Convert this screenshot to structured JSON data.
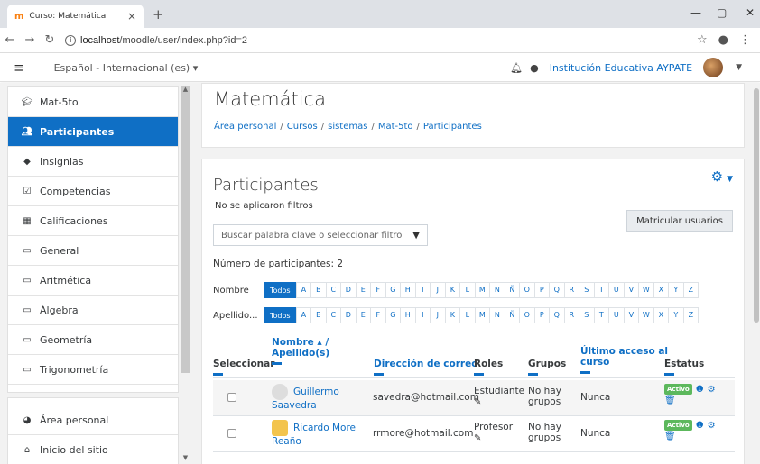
{
  "browser": {
    "tab_title": "Curso: Matemática",
    "tab_favicon": "m",
    "url_host": "localhost",
    "url_path": "/moodle/user/index.php?id=2"
  },
  "navbar": {
    "language": "Español - Internacional (es) ▾",
    "institution": "Institución Educativa AYPATE"
  },
  "sidebar": {
    "items": [
      {
        "label": "Mat-5to",
        "icon": "graduation-cap-icon"
      },
      {
        "label": "Participantes",
        "icon": "users-icon"
      },
      {
        "label": "Insignias",
        "icon": "badge-icon"
      },
      {
        "label": "Competencias",
        "icon": "check-square-icon"
      },
      {
        "label": "Calificaciones",
        "icon": "table-icon"
      },
      {
        "label": "General",
        "icon": "folder-icon"
      },
      {
        "label": "Aritmética",
        "icon": "folder-icon"
      },
      {
        "label": "Álgebra",
        "icon": "folder-icon"
      },
      {
        "label": "Geometría",
        "icon": "folder-icon"
      },
      {
        "label": "Trigonometría",
        "icon": "folder-icon"
      }
    ],
    "bottom_items": [
      {
        "label": "Área personal",
        "icon": "dashboard-icon"
      },
      {
        "label": "Inicio del sitio",
        "icon": "home-icon"
      }
    ]
  },
  "header": {
    "course_title": "Matemática",
    "breadcrumb": [
      "Área personal",
      "Cursos",
      "sistemas",
      "Mat-5to",
      "Participantes"
    ]
  },
  "main": {
    "title": "Participantes",
    "no_filters": "No se aplicaron filtros",
    "enrol_button": "Matricular usuarios",
    "search_placeholder": "Buscar palabra clave o seleccionar filtro",
    "participant_count": "Número de participantes: 2",
    "firstname_label": "Nombre",
    "lastname_label": "Apellido...",
    "all_label": "Todos",
    "letters": [
      "A",
      "B",
      "C",
      "D",
      "E",
      "F",
      "G",
      "H",
      "I",
      "J",
      "K",
      "L",
      "M",
      "N",
      "Ñ",
      "O",
      "P",
      "Q",
      "R",
      "S",
      "T",
      "U",
      "V",
      "W",
      "X",
      "Y",
      "Z"
    ]
  },
  "table": {
    "headers": {
      "select": "Seleccionar",
      "name": "Nombre ▴ /",
      "surname": "Apellido(s)",
      "email": "Dirección de correo",
      "roles": "Roles",
      "groups": "Grupos",
      "last_access_1": "Último acceso al",
      "last_access_2": "curso",
      "status": "Estatus"
    },
    "rows": [
      {
        "first": "Guillermo",
        "last": "Saavedra",
        "email": "savedra@hotmail.com",
        "role": "Estudiante",
        "group1": "No hay",
        "group2": "grupos",
        "access": "Nunca",
        "status": "Activo"
      },
      {
        "first": "Ricardo More",
        "last": "Reaño",
        "email": "rrmore@hotmail.com",
        "role": "Profesor",
        "group1": "No hay",
        "group2": "grupos",
        "access": "Nunca",
        "status": "Activo"
      }
    ]
  }
}
